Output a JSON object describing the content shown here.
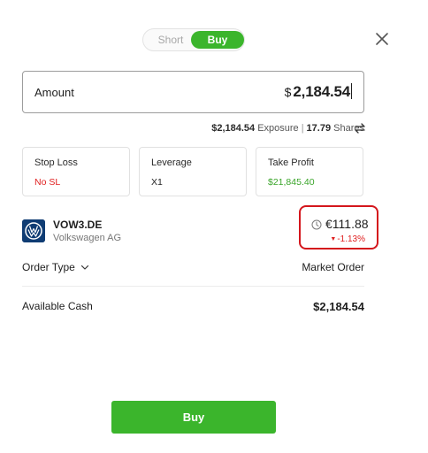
{
  "toggle": {
    "short_label": "Short",
    "buy_label": "Buy",
    "selected": "Buy"
  },
  "icons": {
    "close": "close-icon",
    "swap": "swap-icon",
    "clock": "clock-icon",
    "chevron": "chevron-down-icon",
    "logo": "volkswagen-logo"
  },
  "amount": {
    "label": "Amount",
    "currency": "$",
    "value": "2,184.54"
  },
  "exposure": {
    "exposure_value": "$2,184.54",
    "exposure_label": "Exposure",
    "separator": "|",
    "shares_value": "17.79",
    "shares_label": "Shares"
  },
  "cards": {
    "stop_loss": {
      "title": "Stop Loss",
      "value": "No SL"
    },
    "leverage": {
      "title": "Leverage",
      "value": "X1"
    },
    "take_profit": {
      "title": "Take Profit",
      "value": "$21,845.40"
    }
  },
  "asset": {
    "symbol": "VOW3.DE",
    "name": "Volkswagen AG",
    "price": "€111.88",
    "change": "-1.13%"
  },
  "order": {
    "type_label": "Order Type",
    "type_value": "Market Order"
  },
  "cash": {
    "label": "Available Cash",
    "value": "$2,184.54"
  },
  "action": {
    "button_label": "Buy"
  },
  "colors": {
    "accent_green": "#3bb52c",
    "negative_red": "#e02020",
    "highlight_red": "#d4161c",
    "vw_blue": "#0f3c73"
  }
}
